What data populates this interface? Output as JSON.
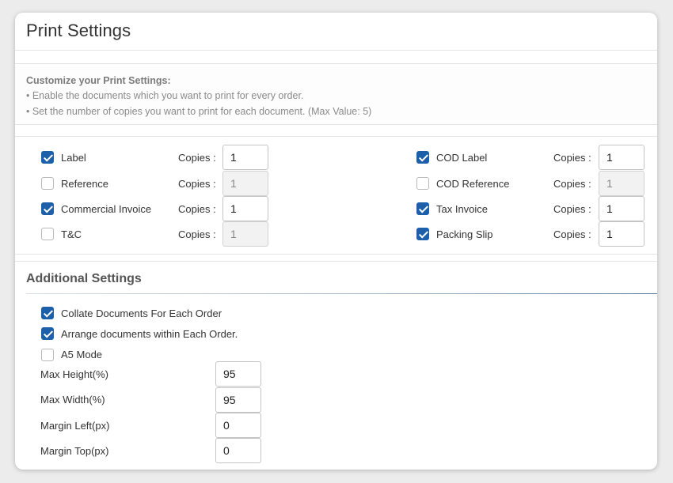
{
  "header": {
    "title": "Print Settings"
  },
  "info": {
    "heading": "Customize your Print Settings:",
    "lines": [
      "• Enable the documents which you want to print for every order.",
      "• Set the number of copies you want to print for each document. (Max Value: 5)"
    ]
  },
  "copies_label": "Copies :",
  "documents_left": [
    {
      "label": "Label",
      "checked": true,
      "copies": "1"
    },
    {
      "label": "Reference",
      "checked": false,
      "copies": "1"
    },
    {
      "label": "Commercial Invoice",
      "checked": true,
      "copies": "1"
    },
    {
      "label": "T&C",
      "checked": false,
      "copies": "1"
    }
  ],
  "documents_right": [
    {
      "label": "COD Label",
      "checked": true,
      "copies": "1"
    },
    {
      "label": "COD Reference",
      "checked": false,
      "copies": "1"
    },
    {
      "label": "Tax Invoice",
      "checked": true,
      "copies": "1"
    },
    {
      "label": "Packing Slip",
      "checked": true,
      "copies": "1"
    }
  ],
  "additional": {
    "title": "Additional Settings",
    "options": [
      {
        "label": "Collate Documents For Each Order",
        "checked": true
      },
      {
        "label": "Arrange documents within Each Order.",
        "checked": true
      },
      {
        "label": "A5 Mode",
        "checked": false
      }
    ],
    "fields": [
      {
        "label": "Max Height(%)",
        "value": "95"
      },
      {
        "label": "Max Width(%)",
        "value": "95"
      },
      {
        "label": "Margin Left(px)",
        "value": "0"
      },
      {
        "label": "Margin Top(px)",
        "value": "0"
      }
    ]
  },
  "colors": {
    "accent": "#1d5fa8"
  }
}
